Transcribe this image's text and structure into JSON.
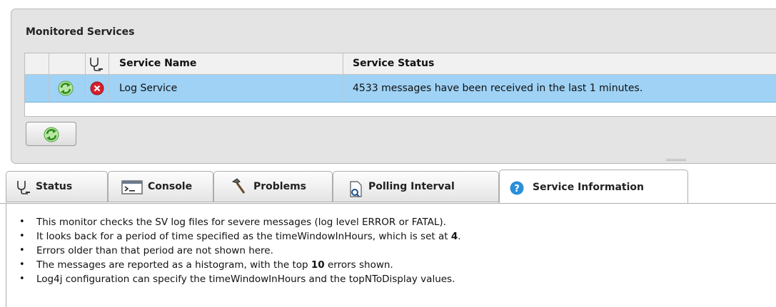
{
  "panel": {
    "title": "Monitored Services"
  },
  "table": {
    "columns": {
      "status_icon": "stethoscope-icon",
      "name": "Service Name",
      "status": "Service Status"
    },
    "rows": [
      {
        "refresh_icon": "refresh-icon",
        "state_icon": "error-icon",
        "name": "Log Service",
        "status": "4533 messages have been received in the last  1 minutes."
      }
    ],
    "selected_row_color": "#9fd2f5"
  },
  "refresh_button": {
    "icon": "refresh-icon"
  },
  "tabs": [
    {
      "label": "Status",
      "icon": "stethoscope-icon",
      "active": false
    },
    {
      "label": "Console",
      "icon": "console-icon",
      "active": false
    },
    {
      "label": "Problems",
      "icon": "hammer-icon",
      "active": false
    },
    {
      "label": "Polling Interval",
      "icon": "document-search-icon",
      "active": false
    },
    {
      "label": "Service Information",
      "icon": "help-icon",
      "active": true
    }
  ],
  "info": {
    "items": [
      {
        "before": "This monitor checks the SV log files for severe messages (log level ERROR or FATAL).",
        "bold": "",
        "after": ""
      },
      {
        "before": "It looks back for a period of time specified as the timeWindowInHours, which is set at ",
        "bold": "4",
        "after": "."
      },
      {
        "before": "Errors older than that period are not shown here.",
        "bold": "",
        "after": ""
      },
      {
        "before": "The messages are reported as a histogram, with the top ",
        "bold": "10",
        "after": " errors shown."
      },
      {
        "before": "Log4j configuration can specify the timeWindowInHours and the topNToDisplay values.",
        "bold": "",
        "after": ""
      }
    ]
  }
}
